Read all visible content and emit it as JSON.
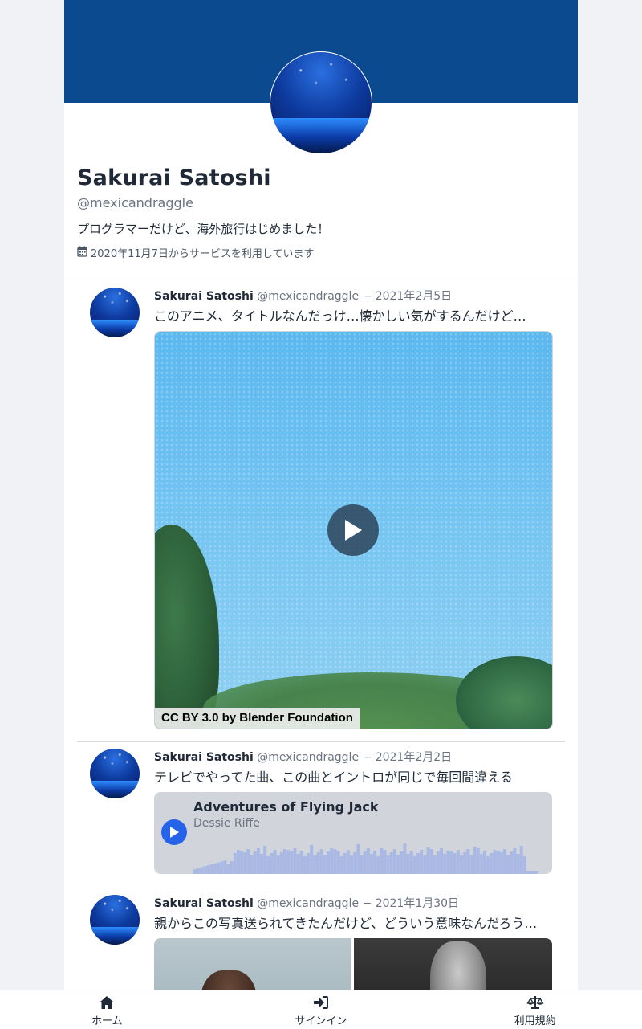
{
  "profile": {
    "name": "Sakurai Satoshi",
    "handle": "@mexicandraggle",
    "bio": "プログラマーだけど、海外旅行はじめました！",
    "joined": "2020年11月7日からサービスを利用しています",
    "banner_color": "#0b4a8f"
  },
  "tweets": [
    {
      "name": "Sakurai Satoshi",
      "meta": "@mexicandraggle − 2021年2月5日",
      "text": "このアニメ、タイトルなんだっけ…懐かしい気がするんだけど…",
      "media_type": "video",
      "video_caption": "CC BY 3.0 by Blender Foundation"
    },
    {
      "name": "Sakurai Satoshi",
      "meta": "@mexicandraggle − 2021年2月2日",
      "text": "テレビでやってた曲、この曲とイントロが同じで毎回間違える",
      "media_type": "audio",
      "audio_title": "Adventures of Flying Jack",
      "audio_artist": "Dessie Riffe"
    },
    {
      "name": "Sakurai Satoshi",
      "meta": "@mexicandraggle − 2021年1月30日",
      "text": "親からこの写真送られてきたんだけど、どういう意味なんだろう…",
      "media_type": "photos"
    }
  ],
  "nav": {
    "home": "ホーム",
    "signin": "サインイン",
    "terms": "利用規約"
  },
  "colors": {
    "accent": "#2563eb",
    "waveform": "#a9b9e3"
  }
}
